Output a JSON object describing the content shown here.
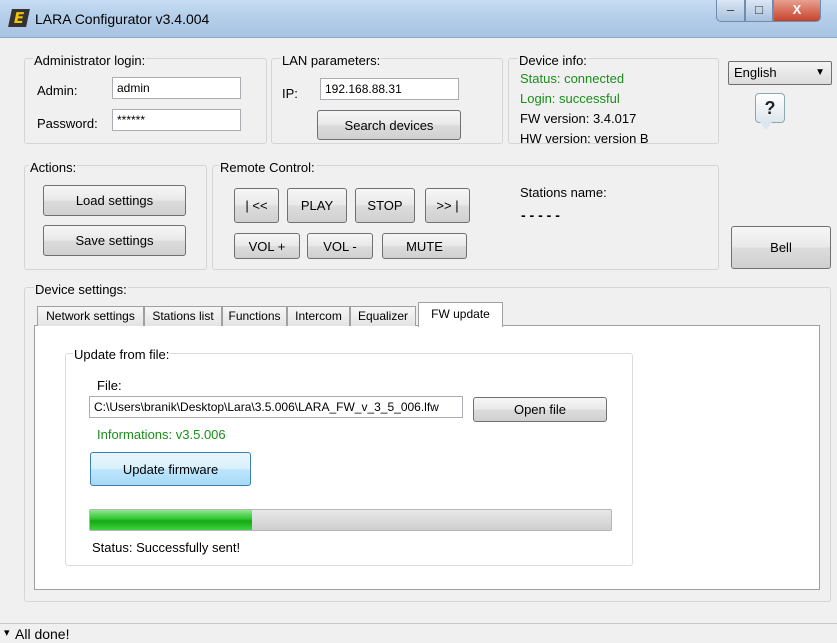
{
  "window": {
    "title": "LARA Configurator v3.4.004",
    "controls": {
      "minimize": "–",
      "maximize": "□",
      "close": "X"
    }
  },
  "admin": {
    "group_label": "Administrator login:",
    "admin_label": "Admin:",
    "admin_value": "admin",
    "password_label": "Password:",
    "password_value": "******"
  },
  "lan": {
    "group_label": "LAN parameters:",
    "ip_label": "IP:",
    "ip_value": "192.168.88.31",
    "search_button": "Search devices"
  },
  "device_info": {
    "group_label": "Device info:",
    "status": "Status: connected",
    "login": "Login: successful",
    "fw_version": "FW version: 3.4.017",
    "hw_version": "HW version: version B"
  },
  "language": {
    "selected": "English",
    "help_label": "?"
  },
  "actions": {
    "group_label": "Actions:",
    "load_button": "Load settings",
    "save_button": "Save settings"
  },
  "remote": {
    "group_label": "Remote Control:",
    "prev_button": "| <<",
    "play_button": "PLAY",
    "stop_button": "STOP",
    "next_button": ">> |",
    "vol_up_button": "VOL +",
    "vol_down_button": "VOL -",
    "mute_button": "MUTE",
    "stations_name_label": "Stations name:",
    "stations_name_value": "- - - - -"
  },
  "bell_button": "Bell",
  "device_settings": {
    "group_label": "Device settings:",
    "tabs": [
      "Network settings",
      "Stations list",
      "Functions",
      "Intercom",
      "Equalizer",
      "FW update"
    ],
    "active_tab": "FW update"
  },
  "fw_update": {
    "group_label": "Update from file:",
    "file_label": "File:",
    "file_path": "C:\\Users\\branik\\Desktop\\Lara\\3.5.006\\LARA_FW_v_3_5_006.lfw",
    "open_button": "Open file",
    "informations": "Informations: v3.5.006",
    "update_button": "Update firmware",
    "progress_fraction": 0.31,
    "status": "Status: Successfully sent!"
  },
  "statusbar": {
    "text": "All done!",
    "grip": "▾"
  },
  "colors": {
    "accent_green": "#1a8d1a",
    "progress_green": "#15a915"
  }
}
